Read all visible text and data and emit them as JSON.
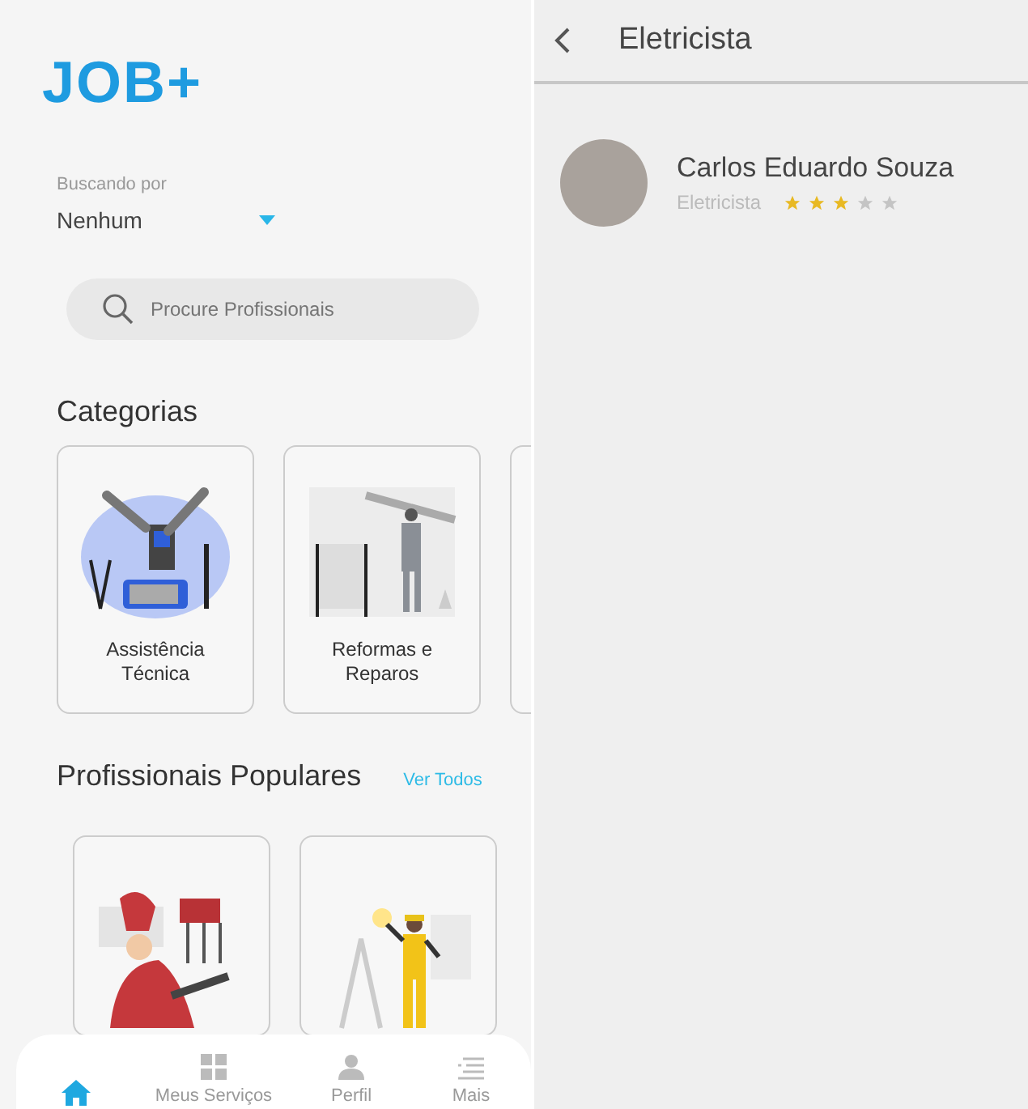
{
  "home": {
    "logo": "JOB+",
    "search_by": {
      "label": "Buscando por",
      "value": "Nenhum"
    },
    "search": {
      "placeholder": "Procure Profissionais"
    },
    "categories": {
      "title": "Categorias",
      "items": [
        {
          "label": "Assistência Técnica",
          "kind": "repair"
        },
        {
          "label": "Reformas e Reparos",
          "kind": "renovation"
        },
        {
          "kind": "partial"
        }
      ]
    },
    "popular": {
      "title": "Profissionais Populares",
      "link": "Ver Todos",
      "items": [
        {
          "kind": "chef"
        },
        {
          "kind": "electrician"
        }
      ]
    },
    "nav": [
      {
        "kind": "home",
        "selected": true
      },
      {
        "kind": "grid",
        "label": "Meus Serviços",
        "selected": false
      },
      {
        "kind": "person",
        "label": "Perfil",
        "selected": false
      },
      {
        "kind": "menu",
        "label": "Mais",
        "selected": false
      }
    ]
  },
  "detail": {
    "title": "Eletricista",
    "professionals": [
      {
        "name": "Carlos Eduardo Souza",
        "role": "Eletricista",
        "stars": 3
      }
    ]
  }
}
